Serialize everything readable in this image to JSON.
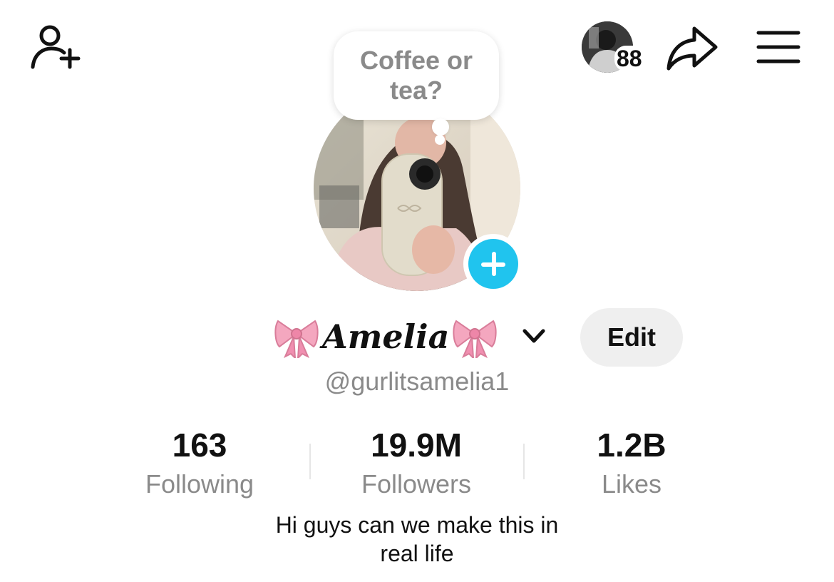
{
  "header": {
    "friends_count": "88",
    "icons": [
      "add-friend-icon",
      "friends-avatar",
      "share-icon",
      "menu-icon"
    ]
  },
  "note": {
    "text": "Coffee or tea?"
  },
  "profile": {
    "display_name": "Amelia",
    "username": "@gurlitsamelia1",
    "edit_label": "Edit",
    "bow_icon": "pink-bow-icon",
    "accent_color": "#20c4ee"
  },
  "stats": [
    {
      "value": "163",
      "label": "Following"
    },
    {
      "value": "19.9M",
      "label": "Followers"
    },
    {
      "value": "1.2B",
      "label": "Likes"
    }
  ],
  "bio": "Hi guys can we make this in real life"
}
